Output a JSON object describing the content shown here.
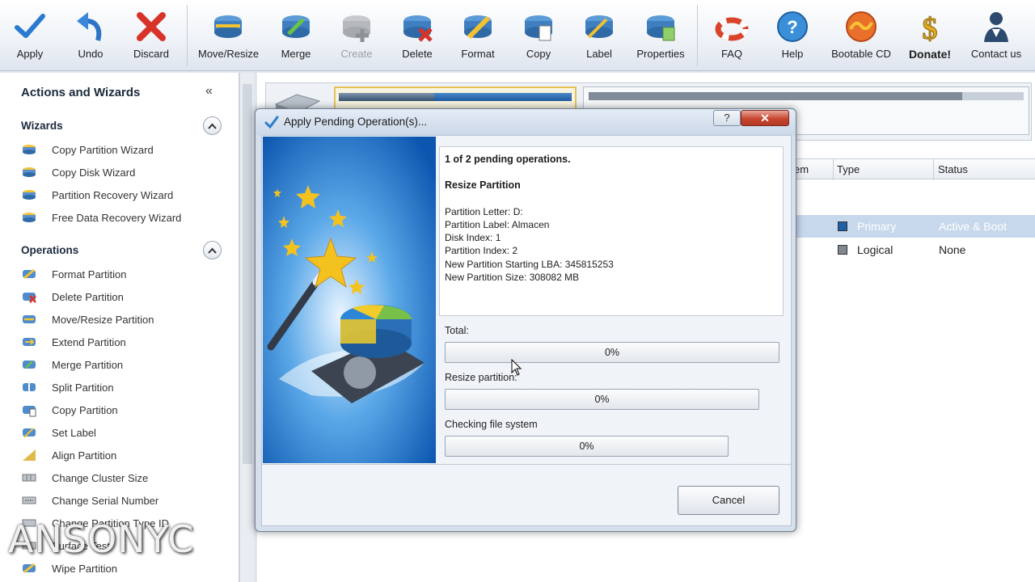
{
  "toolbar": {
    "buttons": [
      {
        "label": "Apply",
        "icon": "checkmark-icon"
      },
      {
        "label": "Undo",
        "icon": "undo-arrow-icon"
      },
      {
        "label": "Discard",
        "icon": "red-x-icon"
      },
      {
        "label": "Move/Resize",
        "icon": "move-resize-disk-icon"
      },
      {
        "label": "Merge",
        "icon": "merge-disk-icon"
      },
      {
        "label": "Create",
        "icon": "create-disk-icon",
        "disabled": true
      },
      {
        "label": "Delete",
        "icon": "delete-disk-icon"
      },
      {
        "label": "Format",
        "icon": "format-disk-icon"
      },
      {
        "label": "Copy",
        "icon": "copy-disk-icon"
      },
      {
        "label": "Label",
        "icon": "label-disk-icon"
      },
      {
        "label": "Properties",
        "icon": "properties-disk-icon"
      },
      {
        "label": "FAQ",
        "icon": "lifebuoy-icon"
      },
      {
        "label": "Help",
        "icon": "help-question-icon"
      },
      {
        "label": "Bootable CD",
        "icon": "bootable-cd-icon"
      },
      {
        "label": "Donate!",
        "icon": "dollar-icon"
      },
      {
        "label": "Contact us",
        "icon": "contact-person-icon"
      }
    ]
  },
  "sidebar": {
    "title": "Actions and Wizards",
    "collapse_glyph": "«",
    "wizards": {
      "heading": "Wizards",
      "items": [
        "Copy Partition Wizard",
        "Copy Disk Wizard",
        "Partition Recovery Wizard",
        "Free Data Recovery Wizard"
      ]
    },
    "operations": {
      "heading": "Operations",
      "items": [
        "Format Partition",
        "Delete Partition",
        "Move/Resize Partition",
        "Extend Partition",
        "Merge Partition",
        "Split Partition",
        "Copy Partition",
        "Set Label",
        "Align Partition",
        "Change Cluster Size",
        "Change Serial Number",
        "Change Partition Type ID",
        "Surface Test",
        "Wipe Partition"
      ]
    }
  },
  "partition_list": {
    "columns": [
      "em",
      "Type",
      "Status"
    ],
    "rows": [
      {
        "type": "Primary",
        "status": "Active & Boot",
        "selected": true,
        "color": "#1f5fa8"
      },
      {
        "type": "Logical",
        "status": "None",
        "selected": false,
        "color": "#808890"
      }
    ]
  },
  "dialog": {
    "title": "Apply Pending Operation(s)...",
    "help_glyph": "?",
    "close_glyph": "✕",
    "details": {
      "summary": "1 of 2 pending operations.",
      "operation": "Resize Partition",
      "lines": [
        "Partition Letter: D:",
        "Partition Label: Almacen",
        "Disk Index: 1",
        "Partition Index: 2",
        "New Partition Starting LBA: 345815253",
        "New Partition Size: 308082 MB"
      ]
    },
    "progress": [
      {
        "label": "Total:",
        "value_text": "0%",
        "fraction": 0
      },
      {
        "label": "Resize partition:",
        "value_text": "0%",
        "fraction": 0
      },
      {
        "label": "Checking file system",
        "value_text": "0%",
        "fraction": 0
      }
    ],
    "cancel_label": "Cancel"
  },
  "watermark": "ANSONYC",
  "colors": {
    "accent_blue": "#1f5fa8",
    "selected_row": "#c8d8ec",
    "close_red": "#c8452f"
  }
}
